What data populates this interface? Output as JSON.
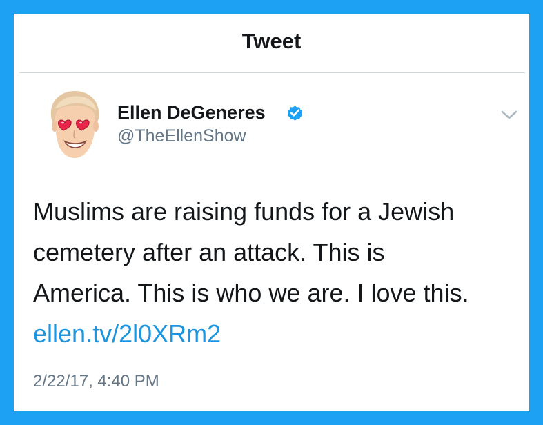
{
  "header": {
    "title": "Tweet"
  },
  "author": {
    "name": "Ellen DeGeneres",
    "handle": "@TheEllenShow",
    "verified": true,
    "avatar_icon": "heart-eyes-emoji-avatar"
  },
  "tweet": {
    "text_lines": [
      "Muslims are raising funds for a Jewish",
      "cemetery after an attack. This is",
      "America. This is who we are. I love this."
    ],
    "link": "ellen.tv/2l0XRm2",
    "timestamp": "2/22/17, 4:40 PM"
  },
  "icons": {
    "verified": "verified-badge-icon",
    "menu": "chevron-down-icon"
  },
  "colors": {
    "border": "#1da1f2",
    "link": "#1b95e0",
    "verified": "#1da1f2",
    "secondary_text": "#657786",
    "primary_text": "#14171a"
  }
}
